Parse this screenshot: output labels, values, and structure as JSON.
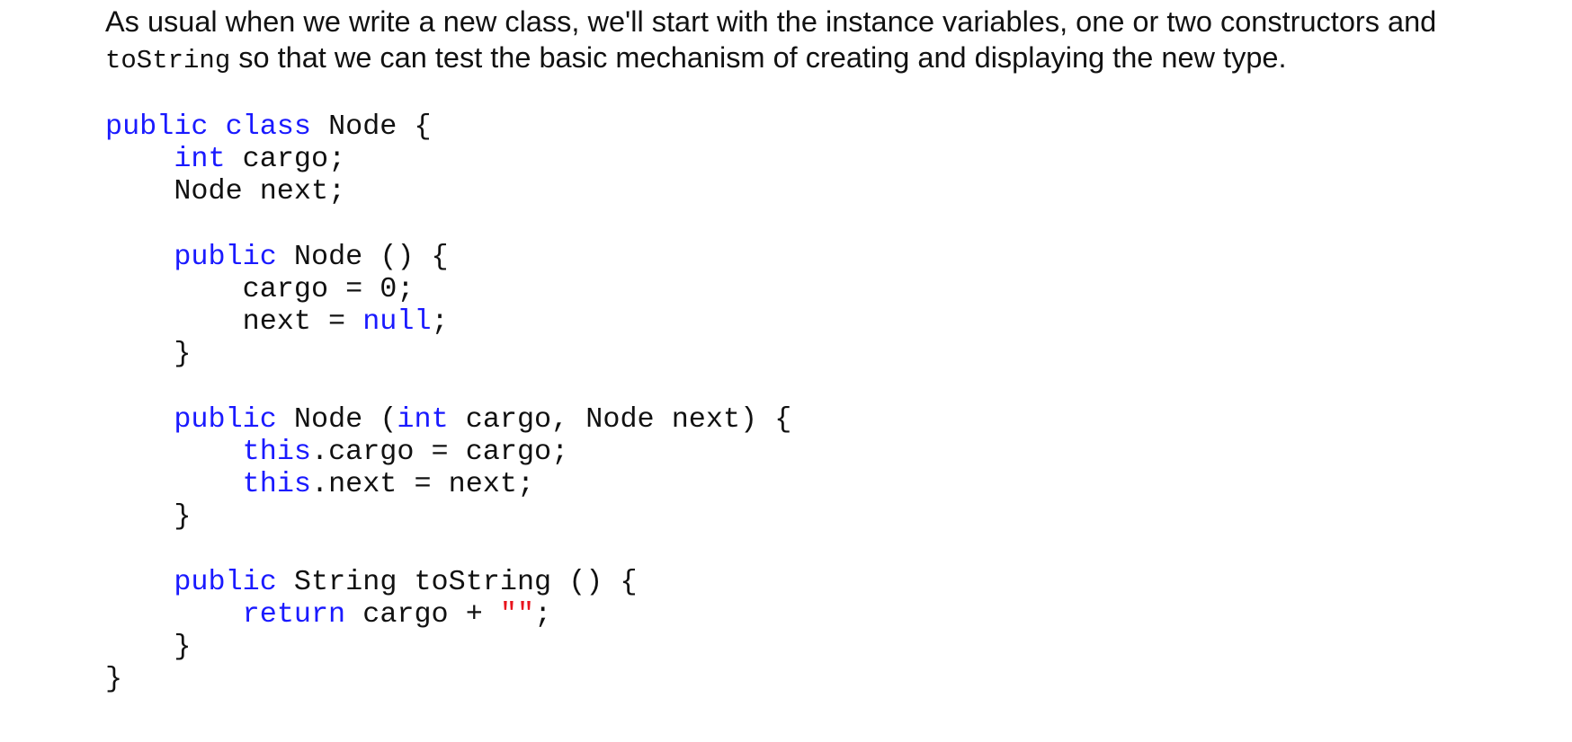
{
  "intro": {
    "text_before": "As usual when we write a new class, we'll start with the instance variables, one or two constructors and ",
    "inline_code": "toString",
    "text_after": " so that we can test the basic mechanism of creating and displaying the new type."
  },
  "code": {
    "language": "java",
    "lines": [
      [
        {
          "t": "kw",
          "v": "public class"
        },
        {
          "t": "plain",
          "v": " Node {"
        }
      ],
      [
        {
          "t": "plain",
          "v": "    "
        },
        {
          "t": "kw",
          "v": "int"
        },
        {
          "t": "plain",
          "v": " cargo;"
        }
      ],
      [
        {
          "t": "plain",
          "v": "    Node next;"
        }
      ],
      [
        {
          "t": "plain",
          "v": ""
        }
      ],
      [
        {
          "t": "plain",
          "v": "    "
        },
        {
          "t": "kw",
          "v": "public"
        },
        {
          "t": "plain",
          "v": " Node () {"
        }
      ],
      [
        {
          "t": "plain",
          "v": "        cargo = 0;"
        }
      ],
      [
        {
          "t": "plain",
          "v": "        next = "
        },
        {
          "t": "kw",
          "v": "null"
        },
        {
          "t": "plain",
          "v": ";"
        }
      ],
      [
        {
          "t": "plain",
          "v": "    }"
        }
      ],
      [
        {
          "t": "plain",
          "v": ""
        }
      ],
      [
        {
          "t": "plain",
          "v": "    "
        },
        {
          "t": "kw",
          "v": "public"
        },
        {
          "t": "plain",
          "v": " Node ("
        },
        {
          "t": "kw",
          "v": "int"
        },
        {
          "t": "plain",
          "v": " cargo, Node next) {"
        }
      ],
      [
        {
          "t": "plain",
          "v": "        "
        },
        {
          "t": "kw",
          "v": "this"
        },
        {
          "t": "plain",
          "v": ".cargo = cargo;"
        }
      ],
      [
        {
          "t": "plain",
          "v": "        "
        },
        {
          "t": "kw",
          "v": "this"
        },
        {
          "t": "plain",
          "v": ".next = next;"
        }
      ],
      [
        {
          "t": "plain",
          "v": "    }"
        }
      ],
      [
        {
          "t": "plain",
          "v": ""
        }
      ],
      [
        {
          "t": "plain",
          "v": "    "
        },
        {
          "t": "kw",
          "v": "public"
        },
        {
          "t": "plain",
          "v": " String toString () {"
        }
      ],
      [
        {
          "t": "plain",
          "v": "        "
        },
        {
          "t": "kw",
          "v": "return"
        },
        {
          "t": "plain",
          "v": " cargo + "
        },
        {
          "t": "str",
          "v": "\"\""
        },
        {
          "t": "plain",
          "v": ";"
        }
      ],
      [
        {
          "t": "plain",
          "v": "    }"
        }
      ],
      [
        {
          "t": "plain",
          "v": "}"
        }
      ]
    ]
  },
  "colors": {
    "keyword": "#1a1aff",
    "string": "#e8141d",
    "text": "#111111",
    "background": "#ffffff"
  }
}
